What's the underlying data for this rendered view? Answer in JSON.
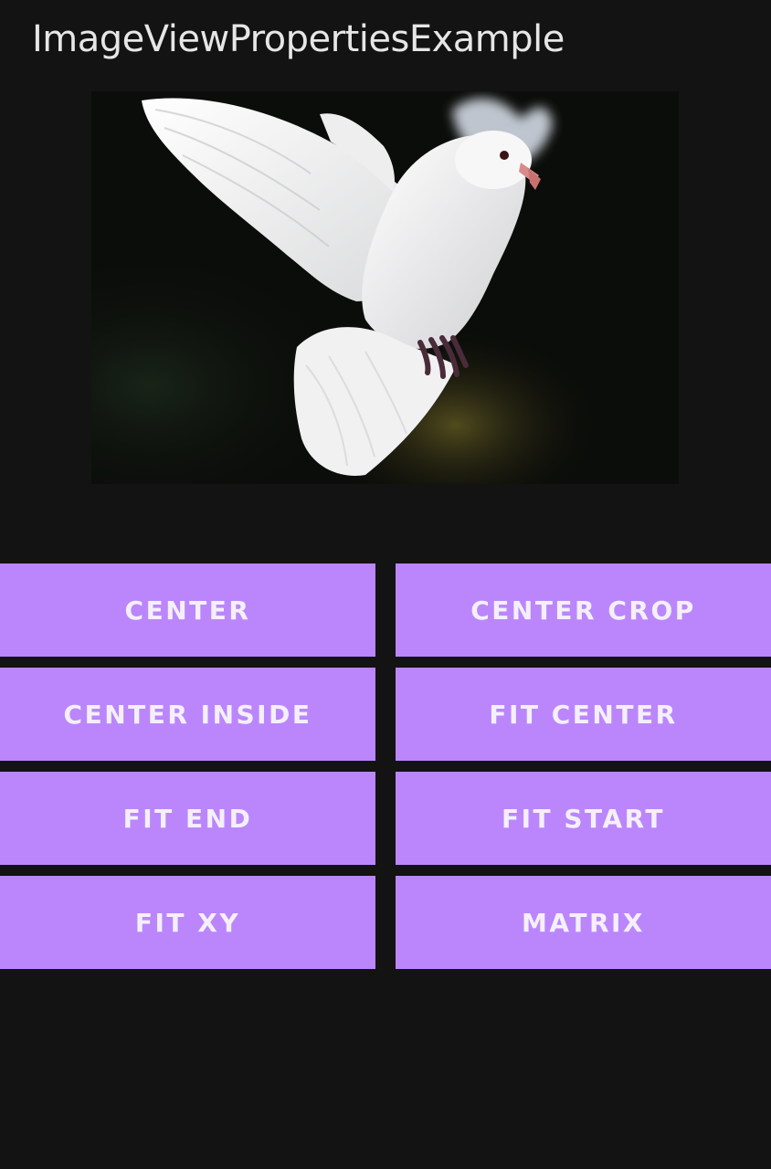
{
  "app": {
    "title": "ImageViewPropertiesExample"
  },
  "image": {
    "subject": "white-dove",
    "background_color": "#0b0d0a"
  },
  "buttons": [
    {
      "label": "CENTER"
    },
    {
      "label": "CENTER CROP"
    },
    {
      "label": "CENTER INSIDE"
    },
    {
      "label": "FIT CENTER"
    },
    {
      "label": "FIT END"
    },
    {
      "label": "FIT START"
    },
    {
      "label": "FIT XY"
    },
    {
      "label": "MATRIX"
    }
  ],
  "colors": {
    "background": "#131313",
    "button": "#bb86fc",
    "button_text": "#f4f0fb",
    "title_text": "#e6e6e6"
  }
}
